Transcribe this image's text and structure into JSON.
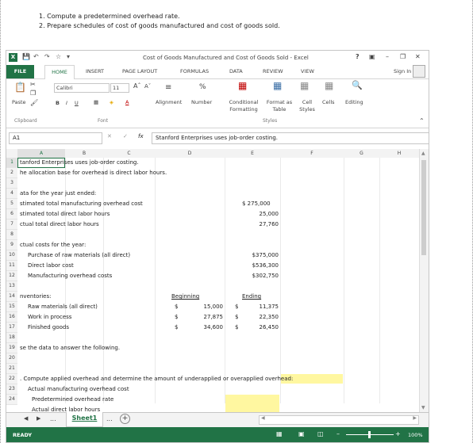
{
  "instructions": {
    "line1": "1. Compute a predetermined overhead rate.",
    "line2": "2. Prepare schedules of cost of goods manufactured and cost of goods sold."
  },
  "window": {
    "app_icon": "X",
    "title": "Cost of Goods Manufactured and Cost of Goods Sold - Excel",
    "help": "?",
    "signin": "Sign In"
  },
  "ribbon_tabs": [
    "FILE",
    "HOME",
    "INSERT",
    "PAGE LAYOUT",
    "FORMULAS",
    "DATA",
    "REVIEW",
    "VIEW"
  ],
  "ribbon": {
    "paste": "Paste",
    "font_name": "Calibri",
    "font_size": "11",
    "bold": "B",
    "italic": "I",
    "underline": "U",
    "alignment": "Alignment",
    "number": "Number",
    "percent": "%",
    "cond_format": "Conditional Formatting",
    "format_table": "Format as Table",
    "cell_styles": "Cell Styles",
    "cells": "Cells",
    "editing": "Editing",
    "groups": {
      "clipboard": "Clipboard",
      "font": "Font",
      "styles": "Styles"
    }
  },
  "formula_bar": {
    "name_box": "A1",
    "fx": "fx",
    "content": "Stanford Enterprises uses job-order costing."
  },
  "columns": [
    "A",
    "B",
    "C",
    "D",
    "E",
    "F",
    "G",
    "H"
  ],
  "rows": [
    "1",
    "2",
    "3",
    "4",
    "5",
    "6",
    "7",
    "8",
    "9",
    "10",
    "11",
    "12",
    "13",
    "14",
    "15",
    "16",
    "17",
    "18",
    "19",
    "20",
    "21",
    "22",
    "23",
    "24"
  ],
  "cells": {
    "r1": "tanford Enterprises uses job-order costing.",
    "r2": "he allocation base for overhead is direct labor hours.",
    "r4": "ata for the year just ended:",
    "r5_label": "stimated total manufacturing overhead cost",
    "r5_val": "$ 275,000",
    "r6_label": "stimated total direct labor hours",
    "r6_val": "25,000",
    "r7_label": "ctual total direct labor hours",
    "r7_val": "27,760",
    "r9": "ctual costs for the year:",
    "r10_label": "Purchase of raw materials (all direct)",
    "r10_val": "$375,000",
    "r11_label": "Direct labor cost",
    "r11_val": "$536,300",
    "r12_label": "Manufacturing overhead costs",
    "r12_val": "$302,750",
    "r14_label": "nventories:",
    "r14_beg": "Beginning",
    "r14_end": "Ending",
    "r15_label": "Raw materials (all direct)",
    "r15_beg": "15,000",
    "r15_end": "11,375",
    "r16_label": "Work in process",
    "r16_beg": "27,875",
    "r16_end": "22,350",
    "r17_label": "Finished goods",
    "r17_beg": "34,600",
    "r17_end": "26,450",
    "dollar": "$",
    "r19": "se the data to answer the following.",
    "r21": ". Compute applied overhead and determine the amount of underapplied or overapplied overhead:",
    "r22": "Actual manufacturing overhead cost",
    "r23": "Predetermined overhead rate",
    "r24": "Actual direct labor hours"
  },
  "sheet_tabs": {
    "active": "Sheet1",
    "more": "...",
    "add": "+"
  },
  "status": {
    "ready": "READY",
    "zoom": "100%"
  },
  "colors": {
    "accent": "#217346",
    "highlight": "#fff7a0"
  }
}
